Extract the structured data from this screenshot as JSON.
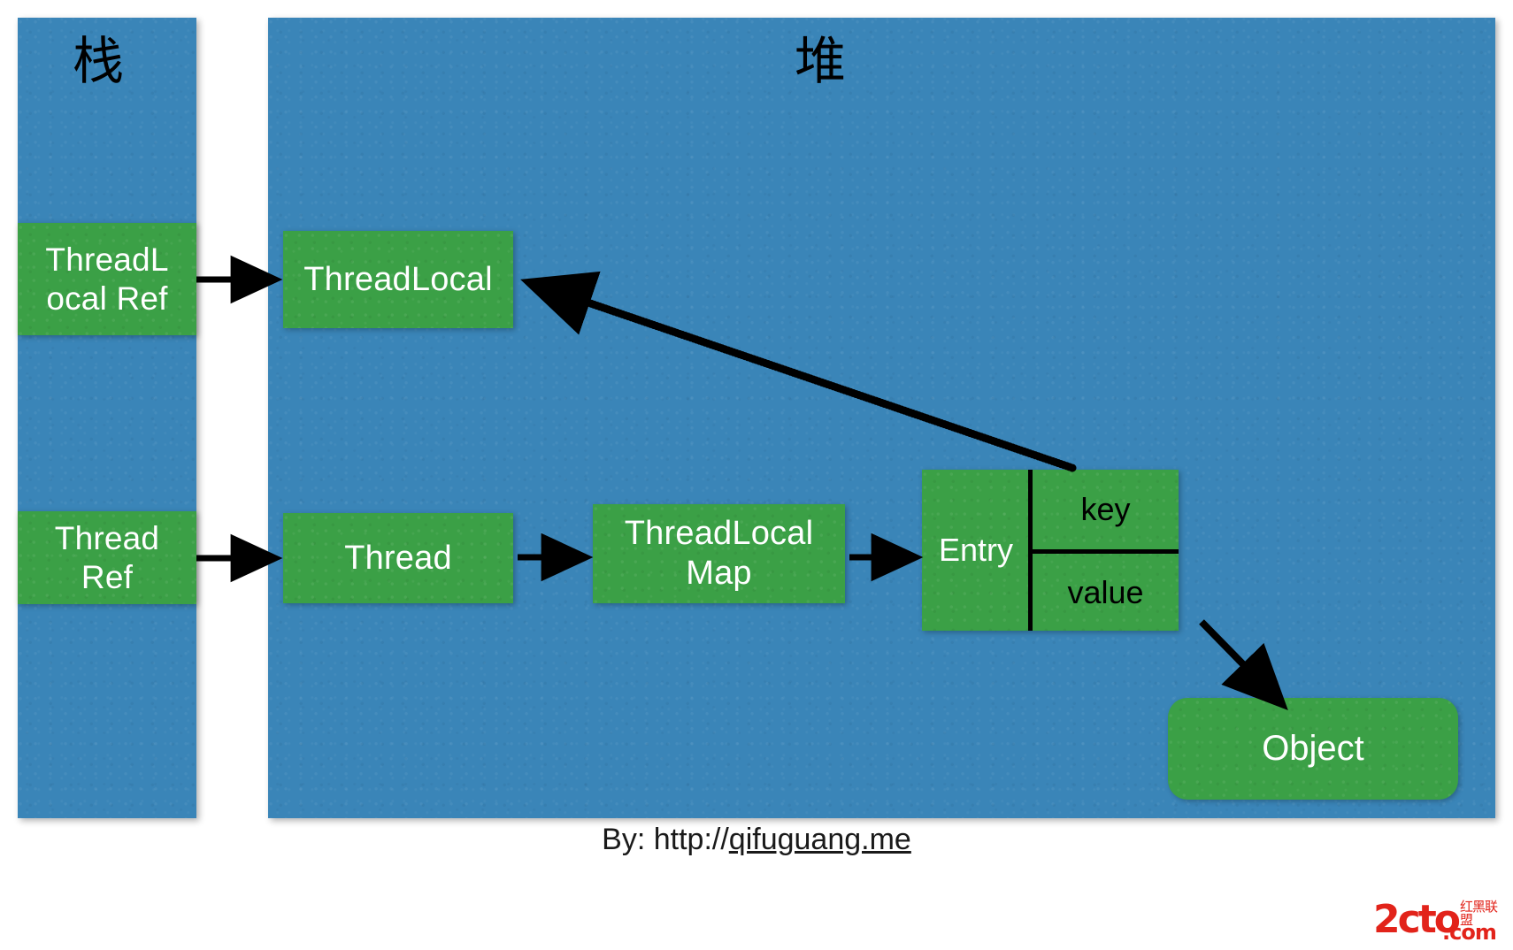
{
  "diagram": {
    "title_stack": "栈",
    "title_heap": "堆",
    "stack": {
      "frames": [
        {
          "label": "ThreadLocal Ref",
          "line1": "ThreadL",
          "line2": "ocal Ref"
        },
        {
          "label": "Thread Ref",
          "line1": "Thread",
          "line2": "Ref"
        }
      ]
    },
    "heap": {
      "threadlocal": "ThreadLocal",
      "thread": "Thread",
      "threadlocalmap_line1": "ThreadLocal",
      "threadlocalmap_line2": "Map",
      "entry": {
        "name": "Entry",
        "key": "key",
        "value": "value"
      },
      "object": "Object"
    },
    "edges": [
      {
        "from": "ThreadLocal Ref",
        "to": "ThreadLocal",
        "style": "solid"
      },
      {
        "from": "Thread Ref",
        "to": "Thread",
        "style": "solid"
      },
      {
        "from": "Thread",
        "to": "ThreadLocalMap",
        "style": "solid"
      },
      {
        "from": "ThreadLocalMap",
        "to": "Entry",
        "style": "solid"
      },
      {
        "from": "Entry.key",
        "to": "ThreadLocal",
        "style": "dotted"
      },
      {
        "from": "Entry.value",
        "to": "Object",
        "style": "solid"
      }
    ]
  },
  "footer": {
    "credit_prefix": "By: http://",
    "credit_link": "qifuguang.me"
  },
  "watermark": {
    "main": "2cto",
    "dotcom": ".com",
    "cn": "红黑联盟"
  },
  "colors": {
    "panel_blue": "#3a85b8",
    "box_green": "#3ba046",
    "box_text": "#ffffff",
    "entry_field_text": "#000000",
    "arrow": "#000000",
    "watermark_red": "#e2231a",
    "page_bg": "#ffffff"
  }
}
